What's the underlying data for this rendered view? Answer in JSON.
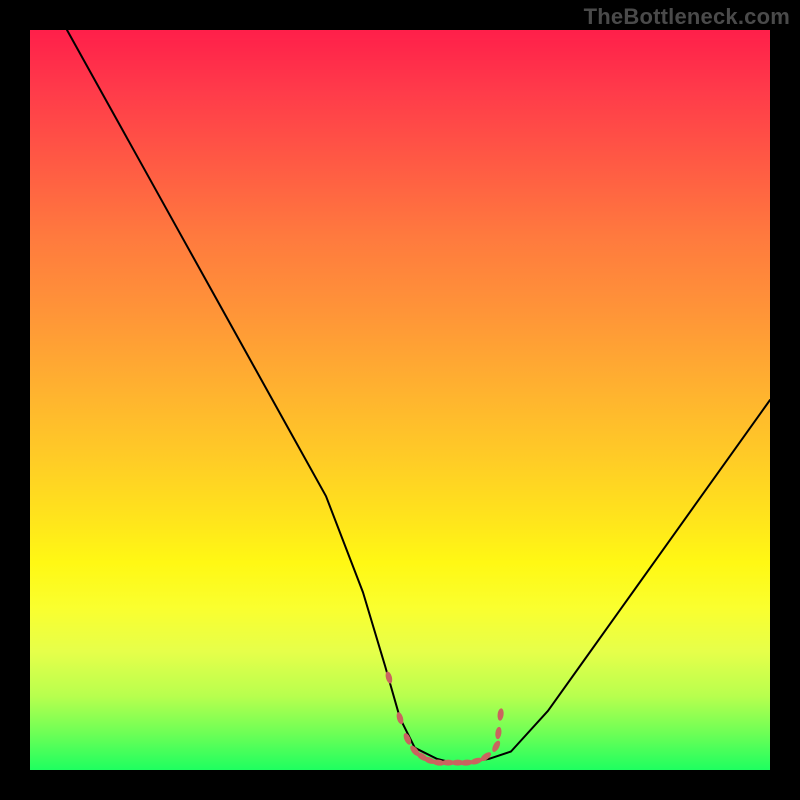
{
  "watermark": "TheBottleneck.com",
  "colors": {
    "background": "#000000",
    "curve": "#000000",
    "marker": "#c9645f",
    "watermark_text": "#4a4a4a"
  },
  "chart_data": {
    "type": "line",
    "title": "",
    "xlabel": "",
    "ylabel": "",
    "xlim": [
      0,
      100
    ],
    "ylim": [
      0,
      100
    ],
    "grid": false,
    "series": [
      {
        "name": "bottleneck-curve",
        "x": [
          5,
          10,
          15,
          20,
          25,
          30,
          35,
          40,
          45,
          48,
          50,
          52,
          55,
          57,
          59,
          62,
          65,
          70,
          75,
          80,
          85,
          90,
          95,
          100
        ],
        "values": [
          100,
          91,
          82,
          73,
          64,
          55,
          46,
          37,
          24,
          14,
          7,
          3,
          1.5,
          1,
          1,
          1.5,
          2.5,
          8,
          15,
          22,
          29,
          36,
          43,
          50
        ]
      }
    ],
    "annotations": [
      {
        "name": "optimal-zone-markers",
        "x": [
          48.5,
          50.0,
          51.0,
          52.0,
          53.0,
          54.0,
          55.2,
          56.5,
          57.8,
          59.0,
          60.3,
          61.6,
          63.0,
          63.3,
          63.6
        ],
        "y": [
          12.5,
          7.0,
          4.2,
          2.6,
          1.8,
          1.3,
          1.0,
          1.0,
          1.0,
          1.0,
          1.2,
          1.8,
          3.2,
          5.0,
          7.5
        ]
      }
    ],
    "background_gradient": {
      "direction": "top-to-bottom",
      "stops": [
        {
          "pos": 0,
          "color": "#ff1f4a"
        },
        {
          "pos": 50,
          "color": "#ffc028"
        },
        {
          "pos": 75,
          "color": "#fff814"
        },
        {
          "pos": 100,
          "color": "#1eff60"
        }
      ]
    }
  }
}
